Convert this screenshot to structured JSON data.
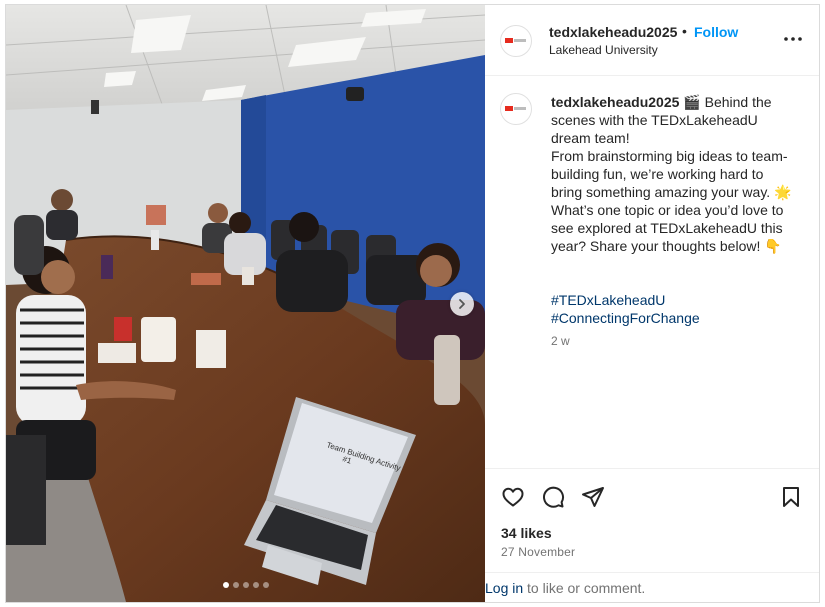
{
  "post": {
    "username": "tedxlakeheadu2025",
    "bullet": "•",
    "follow_label": "Follow",
    "location": "Lakehead University",
    "caption_text": " 🎬 Behind the scenes with the TEDxLakeheadU dream team!\nFrom brainstorming big ideas to team-building fun, we’re working hard to bring something amazing your way. 🌟 What’s one topic or idea you’d love to see explored at TEDxLakeheadU this year? Share your thoughts below! 👇",
    "hashtags": [
      "#TEDxLakeheadU",
      "#ConnectingForChange"
    ],
    "time_ago": "2 w",
    "likes": "34 likes",
    "date": "27 November"
  },
  "media": {
    "carousel_count": 5,
    "active_index": 0,
    "laptop_text_line1": "Team Building Activity",
    "laptop_text_line2": "#1"
  },
  "footer": {
    "login_link": "Log in",
    "login_rest": " to like or comment."
  },
  "icons": {
    "more": "more-options-icon",
    "like": "heart-icon",
    "comment": "comment-icon",
    "share": "share-icon",
    "save": "bookmark-icon",
    "next": "chevron-right-icon"
  },
  "colors": {
    "accent": "#0095f6",
    "link": "#00376b",
    "muted": "#737373",
    "border": "#dbdbdb"
  }
}
